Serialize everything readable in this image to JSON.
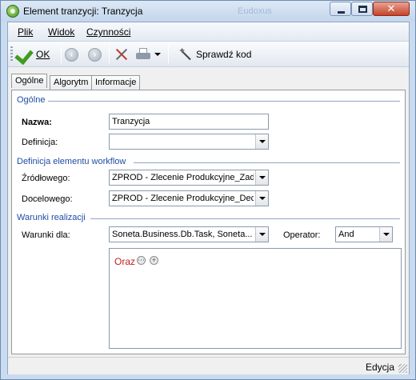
{
  "window": {
    "title": "Element tranzycji: Tranzycja",
    "background_title": "Eudoxus",
    "icon": "app-icon",
    "close_glyph": "✕"
  },
  "menu": {
    "items": [
      {
        "label": "Plik",
        "accesskey": "P"
      },
      {
        "label": "Widok",
        "accesskey": "W"
      },
      {
        "label": "Czynności",
        "accesskey": "C"
      }
    ]
  },
  "toolbar": {
    "ok_label": "OK",
    "ok_icon": "checkmark-icon",
    "back_icon": "back-arrow-icon",
    "forward_icon": "forward-arrow-icon",
    "tools_icon": "tools-icon",
    "print_icon": "printer-icon",
    "check_code_label": "Sprawdź kod",
    "check_code_icon": "magic-wand-icon"
  },
  "tabs": [
    {
      "label": "Ogólne",
      "active": true
    },
    {
      "label": "Algorytm",
      "active": false
    },
    {
      "label": "Informacje",
      "active": false
    }
  ],
  "sections": {
    "general": {
      "header": "Ogólne",
      "name_label": "Nazwa:",
      "name_value": "Tranzycja",
      "definition_label": "Definicja:",
      "definition_value": ""
    },
    "workflow": {
      "header": "Definicja elementu workflow",
      "source_label": "Źródłowego:",
      "source_value": "ZPROD - Zlecenie Produkcyjne_Zadanie",
      "target_label": "Docelowego:",
      "target_value": "ZPROD - Zlecenie Produkcyjne_Decyzja"
    },
    "conditions": {
      "header": "Warunki realizacji",
      "conditions_for_label": "Warunki dla:",
      "conditions_for_value": "Soneta.Business.Db.Task, Soneta...",
      "operator_label": "Operator:",
      "operator_value": "And",
      "oraz_label": "Oraz",
      "ellipsis_glyph": "⋯",
      "plus_glyph": "+",
      "oraz_color": "#c01f1f"
    }
  },
  "status": {
    "mode": "Edycja"
  },
  "colors": {
    "group_header": "#1f4da3",
    "ok_green": "#3d9d1c"
  }
}
